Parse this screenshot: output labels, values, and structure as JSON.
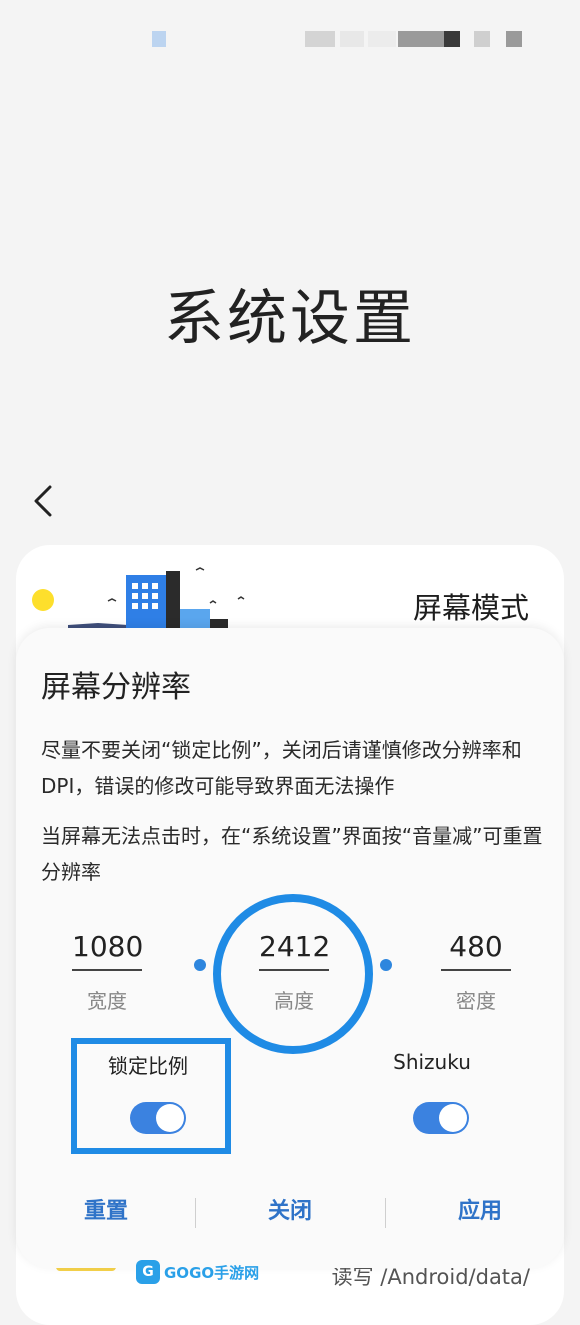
{
  "page": {
    "title": "系统设置"
  },
  "card": {
    "title": "屏幕模式",
    "bottom_text": "读写 /Android/data/"
  },
  "dialog": {
    "title": "屏幕分辨率",
    "message1": "尽量不要关闭“锁定比例”，关闭后请谨慎修改分辨率和DPI，错误的修改可能导致界面无法操作",
    "message2": "当屏幕无法点击时，在“系统设置”界面按“音量减”可重置分辨率",
    "fields": {
      "width": {
        "value": "1080",
        "label": "宽度"
      },
      "height": {
        "value": "2412",
        "label": "高度"
      },
      "density": {
        "value": "480",
        "label": "密度"
      }
    },
    "toggles": {
      "lock_ratio": {
        "label": "锁定比例",
        "on": true
      },
      "shizuku": {
        "label": "Shizuku",
        "on": true
      }
    },
    "buttons": {
      "reset": "重置",
      "close": "关闭",
      "apply": "应用"
    }
  },
  "watermark": {
    "text": "GOGO手游网"
  },
  "colors": {
    "accent": "#1f8be5",
    "toggle_on": "#3b82e0",
    "button_text": "#2f73c8",
    "sun": "#fddf2c"
  },
  "icons": {
    "back": "chevron-left-icon"
  }
}
